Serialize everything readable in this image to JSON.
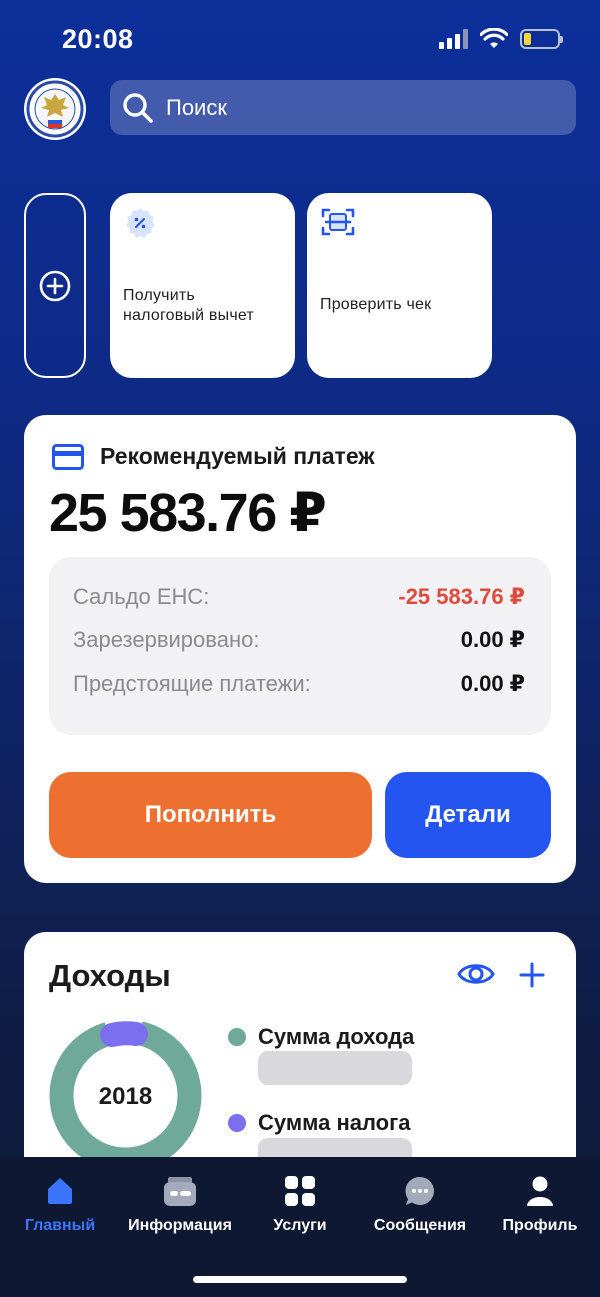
{
  "status": {
    "time": "20:08",
    "battery_fraction": 0.22
  },
  "search": {
    "placeholder": "Поиск"
  },
  "quick_tiles": [
    {
      "label": "Получить\nналоговый вычет",
      "icon": "percent-badge-icon"
    },
    {
      "label": "Проверить чек",
      "icon": "receipt-scan-icon"
    }
  ],
  "payment": {
    "title": "Рекомендуемый платеж",
    "amount": "25 583.76 ₽",
    "rows": [
      {
        "label": "Сальдо ЕНС:",
        "value": "-25 583.76 ₽"
      },
      {
        "label": "Зарезервировано:",
        "value": "0.00 ₽"
      },
      {
        "label": "Предстоящие платежи:",
        "value": "0.00 ₽"
      }
    ],
    "topup_label": "Пополнить",
    "details_label": "Детали"
  },
  "income": {
    "title": "Доходы",
    "year": "2018",
    "legend": [
      {
        "label": "Сумма дохода",
        "color": "#6fa99a"
      },
      {
        "label": "Сумма налога",
        "color": "#7b6ff0"
      }
    ]
  },
  "tabs": [
    {
      "label": "Главный",
      "active": true
    },
    {
      "label": "Информация",
      "active": false
    },
    {
      "label": "Услуги",
      "active": false
    },
    {
      "label": "Сообщения",
      "active": false
    },
    {
      "label": "Профиль",
      "active": false
    }
  ],
  "colors": {
    "accent_blue": "#2455f1",
    "accent_orange": "#ee7030",
    "negative": "#e04a3a",
    "tab_active": "#3b74ff"
  }
}
